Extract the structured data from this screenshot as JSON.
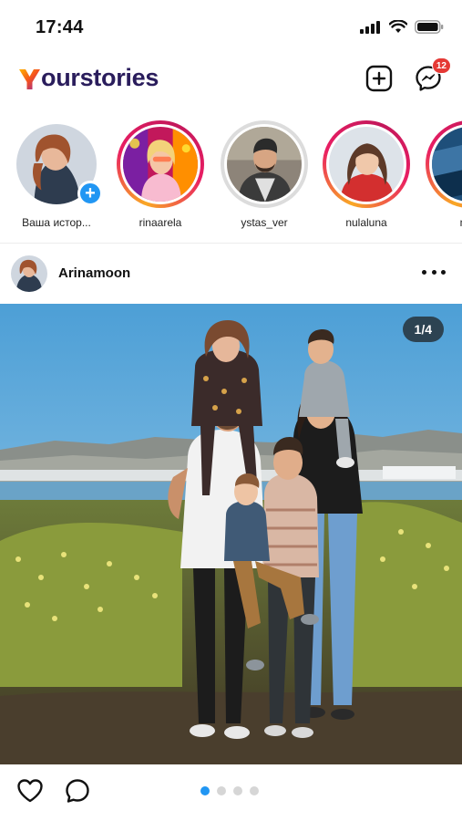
{
  "status_bar": {
    "time": "17:44"
  },
  "header": {
    "logo_text": "ourstories",
    "logo_letter": "Y",
    "messages_badge": "12",
    "icons": [
      "add-square-icon",
      "messenger-icon"
    ]
  },
  "stories": [
    {
      "label": "Ваша истор...",
      "type": "own"
    },
    {
      "label": "rinaarela",
      "type": "active"
    },
    {
      "label": "ystas_ver",
      "type": "seen"
    },
    {
      "label": "nulaluna",
      "type": "active"
    },
    {
      "label": "mer",
      "type": "active"
    }
  ],
  "post": {
    "username": "Arinamoon",
    "counter": "1/4",
    "page_count": 4,
    "current_page": 1
  },
  "actions": {
    "icons": [
      "heart-icon",
      "comment-icon"
    ]
  },
  "colors": {
    "brand": "#2a1d5c",
    "accent": "#2196f3",
    "badge": "#e53935"
  }
}
